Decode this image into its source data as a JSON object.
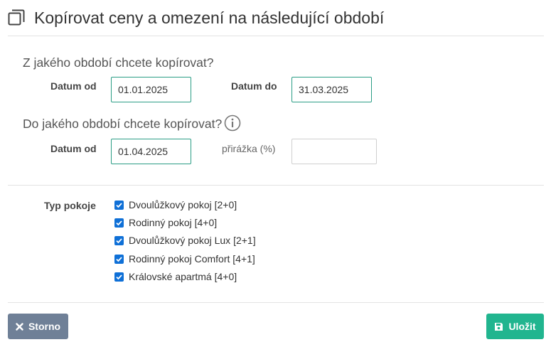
{
  "header": {
    "title": "Kopírovat ceny a omezení na následující období"
  },
  "source_period": {
    "question": "Z jakého období chcete kopírovat?",
    "date_from_label": "Datum od",
    "date_from_value": "01.01.2025",
    "date_to_label": "Datum do",
    "date_to_value": "31.03.2025"
  },
  "target_period": {
    "question": "Do jakého období chcete kopírovat?",
    "date_from_label": "Datum od",
    "date_from_value": "01.04.2025",
    "surcharge_label": "přirážka (%)",
    "surcharge_value": ""
  },
  "room_types": {
    "label": "Typ pokoje",
    "items": [
      {
        "label": "Dvoulůžkový pokoj [2+0]",
        "checked": true
      },
      {
        "label": "Rodinný pokoj [4+0]",
        "checked": true
      },
      {
        "label": "Dvoulůžkový pokoj Lux [2+1]",
        "checked": true
      },
      {
        "label": "Rodinný pokoj Comfort [4+1]",
        "checked": true
      },
      {
        "label": "Královské apartmá [4+0]",
        "checked": true
      }
    ]
  },
  "footer": {
    "cancel_label": "Storno",
    "save_label": "Uložit"
  },
  "colors": {
    "accent": "#2a9d85",
    "checkbox": "#0f70d7",
    "cancel_button": "#6f8097",
    "save_button": "#21b58f"
  },
  "icons": [
    "copy-icon",
    "info-icon",
    "close-icon",
    "save-icon",
    "checkmark-icon"
  ]
}
